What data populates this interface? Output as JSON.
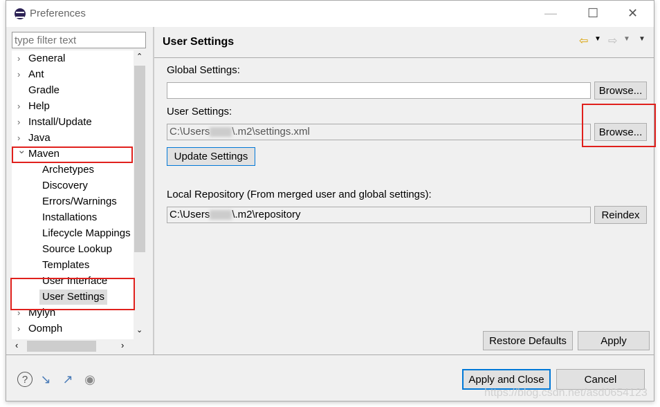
{
  "window": {
    "title": "Preferences"
  },
  "filter": {
    "placeholder": "type filter text"
  },
  "tree": {
    "items": [
      {
        "label": "General",
        "expander": "collapsed"
      },
      {
        "label": "Ant",
        "expander": "collapsed"
      },
      {
        "label": "Gradle",
        "expander": "none"
      },
      {
        "label": "Help",
        "expander": "collapsed"
      },
      {
        "label": "Install/Update",
        "expander": "collapsed"
      },
      {
        "label": "Java",
        "expander": "collapsed"
      },
      {
        "label": "Maven",
        "expander": "expanded"
      },
      {
        "label": "Archetypes",
        "child": true
      },
      {
        "label": "Discovery",
        "child": true
      },
      {
        "label": "Errors/Warnings",
        "child": true
      },
      {
        "label": "Installations",
        "child": true
      },
      {
        "label": "Lifecycle Mappings",
        "child": true
      },
      {
        "label": "Source Lookup",
        "child": true
      },
      {
        "label": "Templates",
        "child": true
      },
      {
        "label": "User Interface",
        "child": true
      },
      {
        "label": "User Settings",
        "child": true,
        "selected": true
      },
      {
        "label": "Mylyn",
        "expander": "collapsed"
      },
      {
        "label": "Oomph",
        "expander": "collapsed"
      }
    ]
  },
  "page": {
    "title": "User Settings",
    "global_label": "Global Settings:",
    "global_value": "",
    "browse1": "Browse...",
    "user_label": "User Settings:",
    "user_value_prefix": "C:\\Users",
    "user_value_suffix": "\\.m2\\settings.xml",
    "browse2": "Browse...",
    "update": "Update Settings",
    "local_label": "Local Repository (From merged user and global settings):",
    "local_prefix": "C:\\Users",
    "local_suffix": "\\.m2\\repository",
    "reindex": "Reindex",
    "restore": "Restore Defaults",
    "apply": "Apply"
  },
  "footer": {
    "apply_close": "Apply and Close",
    "cancel": "Cancel"
  },
  "watermark": "https://blog.csdn.net/asd0654123",
  "colors": {
    "highlight": "#e0201c",
    "default_button_border": "#0078d7"
  }
}
